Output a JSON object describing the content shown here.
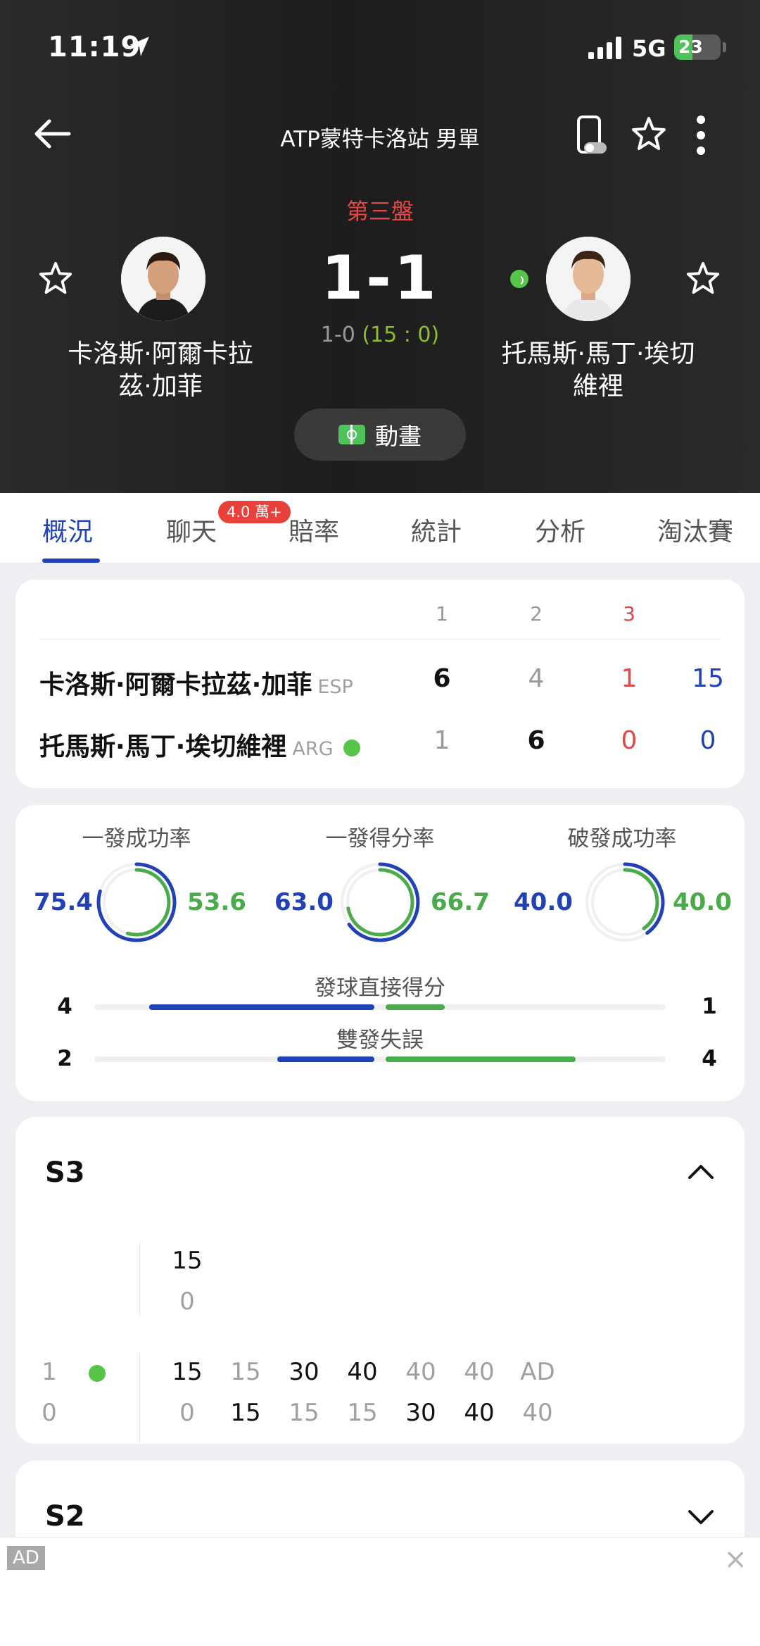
{
  "status": {
    "time": "11:19",
    "network": "5G",
    "battery": "23"
  },
  "nav": {
    "title": "ATP蒙特卡洛站 男單"
  },
  "match": {
    "set_label": "第三盤",
    "score": "1-1",
    "game_score": "1-0",
    "point_score": "(15 : 0)",
    "animation_label": "動畫",
    "player1": {
      "name_line1": "卡洛斯·阿爾卡拉",
      "name_line2": "茲·加菲"
    },
    "player2": {
      "name_line1": "托馬斯·馬丁·埃切",
      "name_line2": "維裡"
    }
  },
  "tabs": [
    {
      "label": "概況"
    },
    {
      "label": "聊天"
    },
    {
      "label": "賠率"
    },
    {
      "label": "統計"
    },
    {
      "label": "分析"
    },
    {
      "label": "淘汰賽"
    }
  ],
  "chat_badge": "4.0 萬+",
  "scoreboard": {
    "headers": [
      "1",
      "2",
      "3"
    ],
    "rows": [
      {
        "name": "卡洛斯·阿爾卡拉茲·加菲",
        "country": "ESP",
        "sets": [
          "6",
          "4",
          "1"
        ],
        "total": "15"
      },
      {
        "name": "托馬斯·馬丁·埃切維裡",
        "country": "ARG",
        "sets": [
          "1",
          "6",
          "0"
        ],
        "total": "0"
      }
    ]
  },
  "stats": {
    "rings": [
      {
        "label": "一發成功率",
        "left": "75.4",
        "right": "53.6"
      },
      {
        "label": "一發得分率",
        "left": "63.0",
        "right": "66.7"
      },
      {
        "label": "破發成功率",
        "left": "40.0",
        "right": "40.0"
      }
    ],
    "bars": [
      {
        "label": "發球直接得分",
        "left": "4",
        "right": "1"
      },
      {
        "label": "雙發失誤",
        "left": "2",
        "right": "4"
      }
    ],
    "colors": {
      "player1": "#2141b6",
      "player2": "#4aab4a"
    }
  },
  "set3": {
    "title": "S3",
    "game1": {
      "p1": "15",
      "p2": "0"
    },
    "game2": {
      "p1_games": "1",
      "p2_games": "0",
      "p1_points": [
        "15",
        "15",
        "30",
        "40",
        "40",
        "40",
        "AD"
      ],
      "p2_points": [
        "0",
        "15",
        "15",
        "15",
        "30",
        "40",
        "40"
      ]
    }
  },
  "set2": {
    "title": "S2"
  },
  "ad": {
    "tag": "AD",
    "close": "×"
  }
}
